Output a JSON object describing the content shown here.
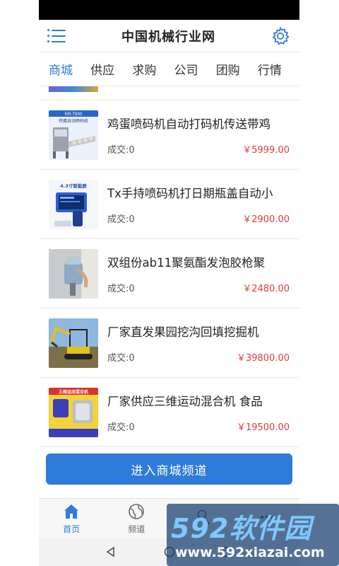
{
  "header": {
    "title": "中国机械行业网"
  },
  "tabs": [
    {
      "label": "商城",
      "active": true
    },
    {
      "label": "供应"
    },
    {
      "label": "求购"
    },
    {
      "label": "公司"
    },
    {
      "label": "团购"
    },
    {
      "label": "行情"
    }
  ],
  "products": [
    {
      "name": "鸡蛋喷码机自动打码机传送带鸡",
      "deal": "成交:0",
      "price": "￥5999.00",
      "thumb_text": [
        "KR-T500",
        "鸡蛋自动喷码机"
      ]
    },
    {
      "name": "Tx手持喷码机打日期瓶盖自动小",
      "deal": "成交:0",
      "price": "￥2900.00",
      "thumb_text": [
        "4.3寸智能屏"
      ]
    },
    {
      "name": "双组份ab11聚氨酯发泡胶枪聚",
      "deal": "成交:0",
      "price": "￥2480.00"
    },
    {
      "name": "厂家直发果园挖沟回填挖掘机",
      "deal": "成交:0",
      "price": "￥39800.00"
    },
    {
      "name": "厂家供应三维运动混合机 食品",
      "deal": "成交:0",
      "price": "￥19500.00",
      "thumb_text": [
        "三维运动混合机"
      ]
    }
  ],
  "enter_button": {
    "label": "进入商城频道"
  },
  "bottom_nav": [
    {
      "label": "首页",
      "icon": "home-icon",
      "active": true
    },
    {
      "label": "频道",
      "icon": "globe-icon"
    },
    {
      "label": "",
      "icon": "user-icon"
    },
    {
      "label": "",
      "icon": "more-icon"
    }
  ],
  "watermark": {
    "main": "592软件园",
    "url": "www.592xiazai.com"
  },
  "colors": {
    "accent": "#2f7bd9",
    "price": "#e0393e"
  }
}
